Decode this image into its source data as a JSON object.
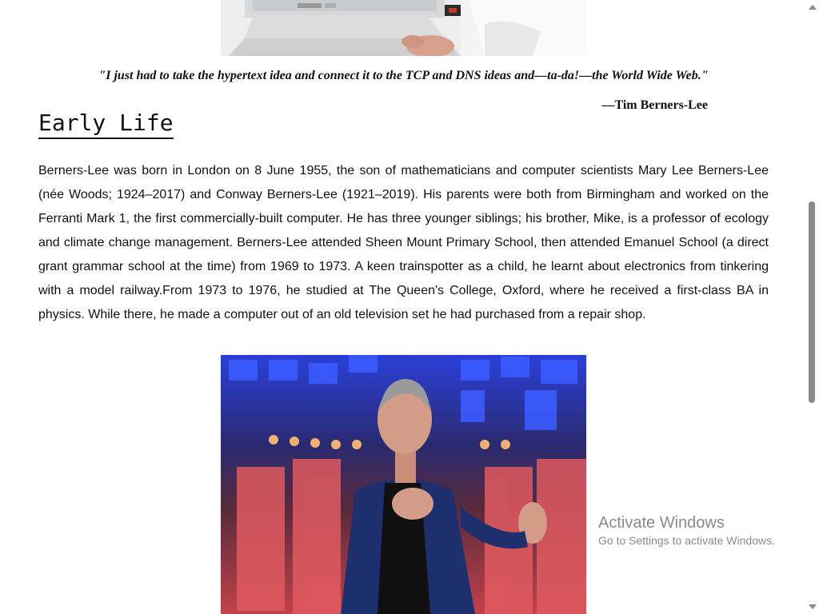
{
  "quote": {
    "text": "\"I just had to take the hypertext idea and connect it to the TCP and DNS ideas and—ta-da!—the World Wide Web.\"",
    "attribution": "—Tim Berners-Lee"
  },
  "section": {
    "heading": "Early Life",
    "body": "Berners-Lee was born in London on 8 June 1955, the son of mathematicians and computer scientists Mary Lee Berners-Lee (née Woods; 1924–2017) and Conway Berners-Lee (1921–2019). His parents were both from Birmingham and worked on the Ferranti Mark 1, the first commercially-built computer. He has three younger siblings; his brother, Mike, is a professor of ecology and climate change management. Berners-Lee attended Sheen Mount Primary School, then attended Emanuel School (a direct grant grammar school at the time) from 1969 to 1973. A keen trainspotter as a child, he learnt about electronics from tinkering with a model railway.From 1973 to 1976, he studied at The Queen's College, Oxford, where he received a first-class BA in physics. While there, he made a computer out of an old television set he had purchased from a repair shop."
  },
  "images": {
    "top": {
      "icon": "computer-photo"
    },
    "main": {
      "icon": "speaker-photo"
    }
  },
  "watermark": {
    "title": "Activate Windows",
    "subtitle": "Go to Settings to activate Windows."
  },
  "colors": {
    "text": "#111111",
    "watermark": "#8a8a8a",
    "scrollbar": "#8a8a8a"
  }
}
